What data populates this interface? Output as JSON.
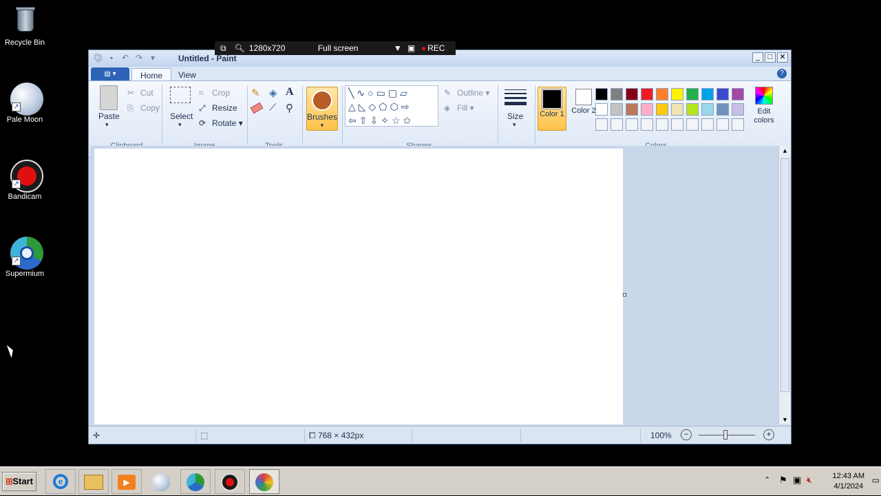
{
  "desktop": {
    "icons": [
      {
        "label": "Recycle Bin"
      },
      {
        "label": "Pale Moon"
      },
      {
        "label": "Bandicam"
      },
      {
        "label": "Supermium"
      }
    ]
  },
  "recorder_toolbar": {
    "resolution": "1280x720",
    "mode": "Full screen",
    "rec_label": "REC"
  },
  "window": {
    "title": "Untitled - Paint"
  },
  "ribbon": {
    "tabs": [
      {
        "label": "Home"
      },
      {
        "label": "View"
      }
    ],
    "clipboard": {
      "paste": "Paste",
      "cut": "Cut",
      "copy": "Copy",
      "group": "Clipboard"
    },
    "image": {
      "select": "Select",
      "crop": "Crop",
      "resize": "Resize",
      "rotate": "Rotate",
      "group": "Image"
    },
    "tools": {
      "group": "Tools"
    },
    "brushes": {
      "label": "Brushes"
    },
    "shapes": {
      "outline": "Outline",
      "fill": "Fill",
      "group": "Shapes"
    },
    "size": {
      "label": "Size"
    },
    "colors": {
      "color1": "Color 1",
      "color2": "Color 2",
      "edit": "Edit colors",
      "group": "Colors",
      "palette_row1": [
        "#000000",
        "#7f7f7f",
        "#880015",
        "#ed1c24",
        "#ff7f27",
        "#fff200",
        "#22b14c",
        "#00a2e8",
        "#3f48cc",
        "#a349a4"
      ],
      "palette_row2": [
        "#ffffff",
        "#c3c3c3",
        "#b97a57",
        "#ffaec9",
        "#ffc90e",
        "#efe4b0",
        "#b5e61d",
        "#99d9ea",
        "#7092be",
        "#c8bfe7"
      ]
    }
  },
  "status": {
    "dimensions": "768 × 432px",
    "zoom": "100%"
  },
  "taskbar": {
    "start": "Start",
    "time": "12:43 AM",
    "date": "4/1/2024"
  }
}
